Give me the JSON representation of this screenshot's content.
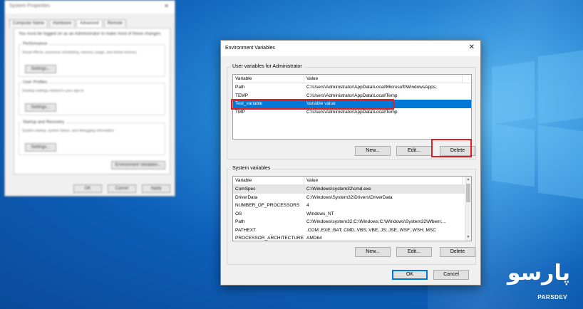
{
  "system_properties": {
    "title": "System Properties",
    "tabs": [
      "Computer Name",
      "Hardware",
      "Advanced",
      "Remote"
    ],
    "note": "You must be logged on as an Administrator to make most of these changes.",
    "groups": [
      {
        "label": "Performance",
        "desc": "Visual effects, processor scheduling, memory usage, and virtual memory",
        "button": "Settings..."
      },
      {
        "label": "User Profiles",
        "desc": "Desktop settings related to your sign-in",
        "button": "Settings..."
      },
      {
        "label": "Startup and Recovery",
        "desc": "System startup, system failure, and debugging information",
        "button": "Settings..."
      }
    ],
    "env_button": "Environment Variables...",
    "footer": {
      "ok": "OK",
      "cancel": "Cancel",
      "apply": "Apply"
    }
  },
  "dialog": {
    "title": "Environment Variables",
    "close": "✕",
    "user_group_label": "User variables for Administrator",
    "user_columns": {
      "variable": "Variable",
      "value": "Value"
    },
    "user_rows": [
      {
        "variable": "Path",
        "value": "C:\\Users\\Administrator\\AppData\\Local\\Microsoft\\WindowsApps;"
      },
      {
        "variable": "TEMP",
        "value": "C:\\Users\\Administrator\\AppData\\Local\\Temp"
      },
      {
        "variable": "Test_variable",
        "value": "Variable value"
      },
      {
        "variable": "TMP",
        "value": "C:\\Users\\Administrator\\AppData\\Local\\Temp"
      }
    ],
    "user_buttons": {
      "new": "New...",
      "edit": "Edit...",
      "delete": "Delete"
    },
    "system_group_label": "System variables",
    "system_columns": {
      "variable": "Variable",
      "value": "Value"
    },
    "system_rows": [
      {
        "variable": "ComSpec",
        "value": "C:\\Windows\\system32\\cmd.exe"
      },
      {
        "variable": "DriverData",
        "value": "C:\\Windows\\System32\\Drivers\\DriverData"
      },
      {
        "variable": "NUMBER_OF_PROCESSORS",
        "value": "4"
      },
      {
        "variable": "OS",
        "value": "Windows_NT"
      },
      {
        "variable": "Path",
        "value": "C:\\Windows\\system32;C:\\Windows;C:\\Windows\\System32\\Wbem;..."
      },
      {
        "variable": "PATHEXT",
        "value": ".COM;.EXE;.BAT;.CMD;.VBS;.VBE;.JS;.JSE;.WSF;.WSH;.MSC"
      },
      {
        "variable": "PROCESSOR_ARCHITECTURE",
        "value": "AMD64"
      }
    ],
    "system_buttons": {
      "new": "New...",
      "edit": "Edit...",
      "delete": "Delete"
    },
    "footer": {
      "ok": "OK",
      "cancel": "Cancel"
    }
  },
  "brand": {
    "logo": "پارسو",
    "sub": "PARSDEV"
  },
  "colors": {
    "selection": "#0078d7",
    "highlight_box": "#e02020",
    "desktop": "#0d5fb8"
  }
}
